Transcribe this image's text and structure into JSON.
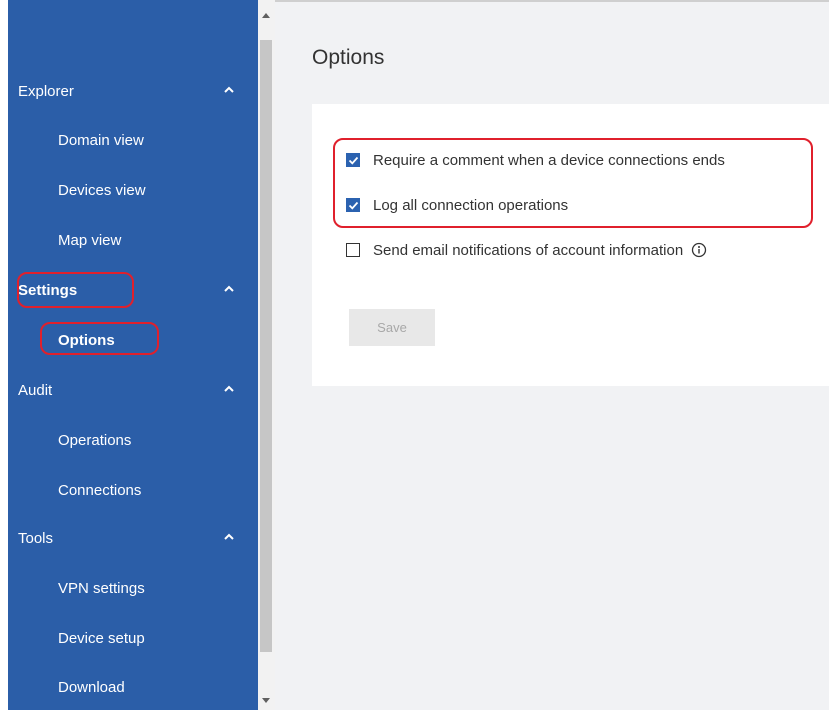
{
  "sidebar": {
    "sections": [
      {
        "label": "Explorer",
        "items": [
          "Domain view",
          "Devices view",
          "Map view"
        ]
      },
      {
        "label": "Settings",
        "items": [
          "Options"
        ]
      },
      {
        "label": "Audit",
        "items": [
          "Operations",
          "Connections"
        ]
      },
      {
        "label": "Tools",
        "items": [
          "VPN settings",
          "Device setup",
          "Download"
        ]
      }
    ]
  },
  "main": {
    "title": "Options",
    "options": [
      {
        "label": "Require a comment when a device connections ends",
        "checked": true
      },
      {
        "label": "Log all connection operations",
        "checked": true
      },
      {
        "label": "Send email notifications of account information",
        "checked": false
      }
    ],
    "save_label": "Save"
  },
  "colors": {
    "sidebar": "#2b5ea8",
    "checkbox": "#2b62b0",
    "highlight": "#e0202c",
    "content_bg": "#f1f2f4"
  },
  "icons": {
    "section_chevron": "chevron-up-icon",
    "info": "info-icon",
    "checkmark": "checkmark-icon"
  }
}
